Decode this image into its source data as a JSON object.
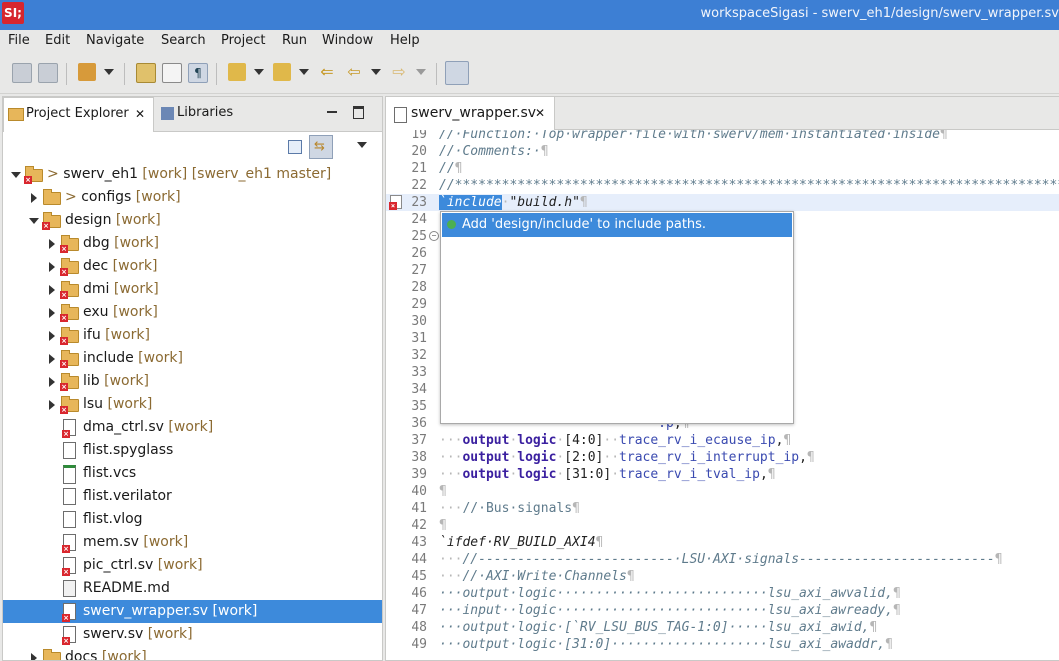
{
  "window": {
    "logo": "SI;",
    "title": "workspaceSigasi - swerv_eh1/design/swerv_wrapper.sv"
  },
  "menu": [
    "File",
    "Edit",
    "Navigate",
    "Search",
    "Project",
    "Run",
    "Window",
    "Help"
  ],
  "left_panel": {
    "tabs": [
      {
        "label": "Project Explorer",
        "active": true,
        "close": "✕"
      },
      {
        "label": "Libraries",
        "active": false
      }
    ],
    "tree": [
      {
        "prefix": "> ",
        "name": "swerv_eh1",
        "deco": " [work] [swerv_eh1 master]",
        "depth": 0,
        "arrow": "down",
        "icon": "project-icon"
      },
      {
        "prefix": "> ",
        "name": "configs",
        "deco": " [work]",
        "depth": 1,
        "arrow": "right",
        "icon": "folder-icon"
      },
      {
        "prefix": "",
        "name": "design",
        "deco": " [work]",
        "depth": 1,
        "arrow": "down",
        "icon": "folder-error-icon"
      },
      {
        "prefix": "",
        "name": "dbg",
        "deco": " [work]",
        "depth": 2,
        "arrow": "right",
        "icon": "folder-error-icon"
      },
      {
        "prefix": "",
        "name": "dec",
        "deco": " [work]",
        "depth": 2,
        "arrow": "right",
        "icon": "folder-error-icon"
      },
      {
        "prefix": "",
        "name": "dmi",
        "deco": " [work]",
        "depth": 2,
        "arrow": "right",
        "icon": "folder-error-icon"
      },
      {
        "prefix": "",
        "name": "exu",
        "deco": " [work]",
        "depth": 2,
        "arrow": "right",
        "icon": "folder-error-icon"
      },
      {
        "prefix": "",
        "name": "ifu",
        "deco": " [work]",
        "depth": 2,
        "arrow": "right",
        "icon": "folder-error-icon"
      },
      {
        "prefix": "",
        "name": "include",
        "deco": " [work]",
        "depth": 2,
        "arrow": "right",
        "icon": "folder-error-icon"
      },
      {
        "prefix": "",
        "name": "lib",
        "deco": " [work]",
        "depth": 2,
        "arrow": "right",
        "icon": "folder-error-icon"
      },
      {
        "prefix": "",
        "name": "lsu",
        "deco": " [work]",
        "depth": 2,
        "arrow": "right",
        "icon": "folder-error-icon"
      },
      {
        "prefix": "",
        "name": "dma_ctrl.sv",
        "deco": " [work]",
        "depth": 2,
        "arrow": "",
        "icon": "sv-file-error-icon"
      },
      {
        "prefix": "",
        "name": "flist.spyglass",
        "deco": "",
        "depth": 2,
        "arrow": "",
        "icon": "file-icon"
      },
      {
        "prefix": "",
        "name": "flist.vcs",
        "deco": "",
        "depth": 2,
        "arrow": "",
        "icon": "calendar-file-icon"
      },
      {
        "prefix": "",
        "name": "flist.verilator",
        "deco": "",
        "depth": 2,
        "arrow": "",
        "icon": "file-icon"
      },
      {
        "prefix": "",
        "name": "flist.vlog",
        "deco": "",
        "depth": 2,
        "arrow": "",
        "icon": "file-icon"
      },
      {
        "prefix": "",
        "name": "mem.sv",
        "deco": " [work]",
        "depth": 2,
        "arrow": "",
        "icon": "sv-file-error-icon"
      },
      {
        "prefix": "",
        "name": "pic_ctrl.sv",
        "deco": " [work]",
        "depth": 2,
        "arrow": "",
        "icon": "sv-file-error-icon"
      },
      {
        "prefix": "",
        "name": "README.md",
        "deco": "",
        "depth": 2,
        "arrow": "",
        "icon": "markdown-file-icon"
      },
      {
        "prefix": "",
        "name": "swerv_wrapper.sv",
        "deco": " [work]",
        "depth": 2,
        "arrow": "",
        "icon": "sv-file-error-icon",
        "selected": true
      },
      {
        "prefix": "",
        "name": "swerv.sv",
        "deco": " [work]",
        "depth": 2,
        "arrow": "",
        "icon": "sv-file-error-icon"
      },
      {
        "prefix": "",
        "name": "docs",
        "deco": " [work]",
        "depth": 1,
        "arrow": "right",
        "icon": "folder-icon"
      }
    ]
  },
  "editor": {
    "tab": {
      "label": "swerv_wrapper.sv",
      "close": "✕"
    },
    "quickfix": "Add 'design/include' to include paths.",
    "lines": [
      {
        "n": "19",
        "html": "<span class=\"cmt\">//·Function:·Top·wrapper·file·with·swerv/mem·instantiated·inside</span><span class=\"ws\">¶</span>"
      },
      {
        "n": "20",
        "html": "<span class=\"cmt\">//·Comments:·</span><span class=\"ws\">¶</span>"
      },
      {
        "n": "21",
        "html": "<span class=\"cmt\">//</span><span class=\"ws\">¶</span>"
      },
      {
        "n": "22",
        "html": "<span class=\"cmt\">//********************************************************************************</span>"
      },
      {
        "n": "23",
        "cur": true,
        "err": true,
        "html": "<span class=\"hl dir\">`include</span><span class=\"ws\">·</span><span class=\"dir\">\"build.h\"</span><span class=\"ws\">¶</span>"
      },
      {
        "n": "24",
        "html": ""
      },
      {
        "n": "25",
        "fold": true,
        "html": ""
      },
      {
        "n": "26",
        "html": ""
      },
      {
        "n": "27",
        "html": ""
      },
      {
        "n": "28",
        "html": ""
      },
      {
        "n": "29",
        "html": "<span class=\"ws\">                            ¶</span>"
      },
      {
        "n": "30",
        "html": "<span class=\"ws\">                            »  »  »  ····¶</span>"
      },
      {
        "n": "31",
        "html": ""
      },
      {
        "n": "32",
        "html": ""
      },
      {
        "n": "33",
        "html": ""
      },
      {
        "n": "34",
        "html": "<span class=\"ws\">                            ¶</span>"
      },
      {
        "n": "35",
        "html": ""
      },
      {
        "n": "36",
        "html": "<span class=\"ws\">                            </span><span class=\"sig\">.p</span><span>,</span><span class=\"ws\">¶</span>"
      },
      {
        "n": "37",
        "html": "<span class=\"ws\">···</span><span class=\"kw\">output</span><span class=\"ws\">·</span><span class=\"kw\">logic</span><span class=\"ws\">·</span>[4:0]<span class=\"ws\">··</span><span class=\"sig\">trace_rv_i_ecause_ip</span>,<span class=\"ws\">¶</span>"
      },
      {
        "n": "38",
        "html": "<span class=\"ws\">···</span><span class=\"kw\">output</span><span class=\"ws\">·</span><span class=\"kw\">logic</span><span class=\"ws\">·</span>[2:0]<span class=\"ws\">··</span><span class=\"sig\">trace_rv_i_interrupt_ip</span>,<span class=\"ws\">¶</span>"
      },
      {
        "n": "39",
        "html": "<span class=\"ws\">···</span><span class=\"kw\">output</span><span class=\"ws\">·</span><span class=\"kw\">logic</span><span class=\"ws\">·</span>[31:0]<span class=\"ws\">·</span><span class=\"sig\">trace_rv_i_tval_ip</span>,<span class=\"ws\">¶</span>"
      },
      {
        "n": "40",
        "html": "<span class=\"ws\">¶</span>"
      },
      {
        "n": "41",
        "html": "<span class=\"ws\">···</span><span class=\"cmt\" style=\"font-style:normal\">//·Bus·signals</span><span class=\"ws\">¶</span>"
      },
      {
        "n": "42",
        "html": "<span class=\"ws\">¶</span>"
      },
      {
        "n": "43",
        "html": "<span class=\"dir\">`ifdef·RV_BUILD_AXI4</span><span class=\"ws\">¶</span>"
      },
      {
        "n": "44",
        "html": "<span class=\"ws\">···</span><span class=\"cmt\">//-------------------------·LSU·AXI·signals-------------------------</span><span class=\"ws\">¶</span>"
      },
      {
        "n": "45",
        "html": "<span class=\"ws\">···</span><span class=\"cmt\">//·AXI·Write·Channels</span><span class=\"ws\">¶</span>"
      },
      {
        "n": "46",
        "html": "<span class=\"cmt\">···output·logic···························lsu_axi_awvalid,</span><span class=\"ws\">¶</span>"
      },
      {
        "n": "47",
        "html": "<span class=\"cmt\">···input··logic···························lsu_axi_awready,</span><span class=\"ws\">¶</span>"
      },
      {
        "n": "48",
        "html": "<span class=\"cmt\">···output·logic·[`RV_LSU_BUS_TAG-1:0]·····lsu_axi_awid,</span><span class=\"ws\">¶</span>"
      },
      {
        "n": "49",
        "html": "<span class=\"cmt\">···output·logic·[31:0]····················lsu_axi_awaddr,</span><span class=\"ws\">¶</span>"
      }
    ]
  }
}
